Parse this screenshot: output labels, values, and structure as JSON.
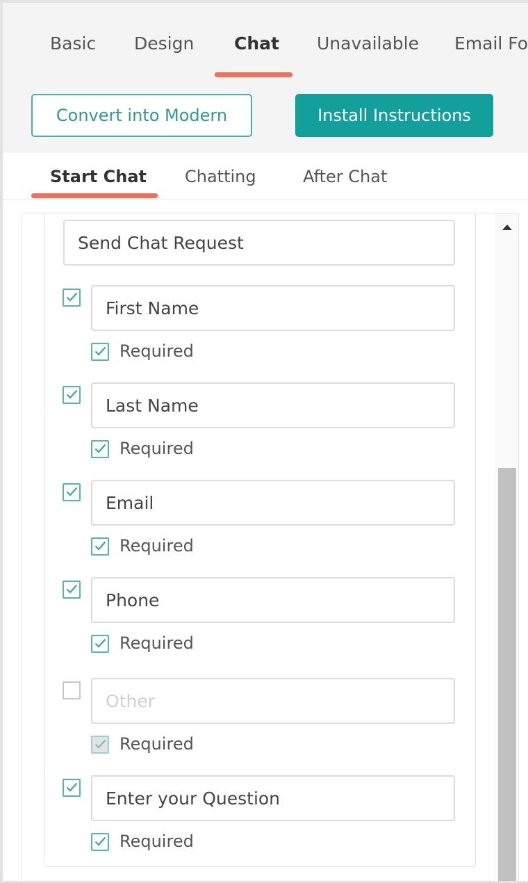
{
  "main_tabs": [
    {
      "label": "Basic",
      "active": false
    },
    {
      "label": "Design",
      "active": false
    },
    {
      "label": "Chat",
      "active": true
    },
    {
      "label": "Unavailable",
      "active": false
    },
    {
      "label": "Email For",
      "active": false
    }
  ],
  "buttons": {
    "convert": "Convert into Modern",
    "install": "Install Instructions"
  },
  "sub_tabs": [
    {
      "label": "Start Chat",
      "active": true
    },
    {
      "label": "Chatting",
      "active": false
    },
    {
      "label": "After Chat",
      "active": false
    }
  ],
  "form": {
    "send_button_text": "Send Chat Request",
    "required_label": "Required",
    "fields": [
      {
        "value": "First Name",
        "placeholder": "",
        "enabled": true,
        "required": true
      },
      {
        "value": "Last Name",
        "placeholder": "",
        "enabled": true,
        "required": true
      },
      {
        "value": "Email",
        "placeholder": "",
        "enabled": true,
        "required": true
      },
      {
        "value": "Phone",
        "placeholder": "",
        "enabled": true,
        "required": true
      },
      {
        "value": "",
        "placeholder": "Other",
        "enabled": false,
        "required": true
      },
      {
        "value": "Enter your Question",
        "placeholder": "",
        "enabled": true,
        "required": true
      }
    ]
  },
  "colors": {
    "accent_teal": "#139f9c",
    "tab_underline": "#f37058"
  }
}
